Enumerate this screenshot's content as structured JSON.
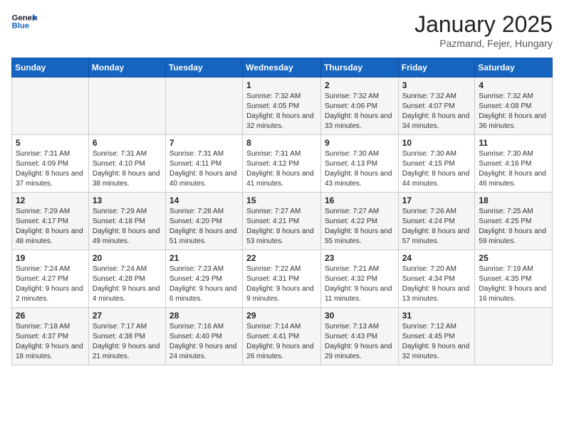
{
  "header": {
    "logo_general": "General",
    "logo_blue": "Blue",
    "month": "January 2025",
    "location": "Pazmand, Fejer, Hungary"
  },
  "days_of_week": [
    "Sunday",
    "Monday",
    "Tuesday",
    "Wednesday",
    "Thursday",
    "Friday",
    "Saturday"
  ],
  "weeks": [
    [
      {
        "day": "",
        "info": ""
      },
      {
        "day": "",
        "info": ""
      },
      {
        "day": "",
        "info": ""
      },
      {
        "day": "1",
        "info": "Sunrise: 7:32 AM\nSunset: 4:05 PM\nDaylight: 8 hours and 32 minutes."
      },
      {
        "day": "2",
        "info": "Sunrise: 7:32 AM\nSunset: 4:06 PM\nDaylight: 8 hours and 33 minutes."
      },
      {
        "day": "3",
        "info": "Sunrise: 7:32 AM\nSunset: 4:07 PM\nDaylight: 8 hours and 34 minutes."
      },
      {
        "day": "4",
        "info": "Sunrise: 7:32 AM\nSunset: 4:08 PM\nDaylight: 8 hours and 36 minutes."
      }
    ],
    [
      {
        "day": "5",
        "info": "Sunrise: 7:31 AM\nSunset: 4:09 PM\nDaylight: 8 hours and 37 minutes."
      },
      {
        "day": "6",
        "info": "Sunrise: 7:31 AM\nSunset: 4:10 PM\nDaylight: 8 hours and 38 minutes."
      },
      {
        "day": "7",
        "info": "Sunrise: 7:31 AM\nSunset: 4:11 PM\nDaylight: 8 hours and 40 minutes."
      },
      {
        "day": "8",
        "info": "Sunrise: 7:31 AM\nSunset: 4:12 PM\nDaylight: 8 hours and 41 minutes."
      },
      {
        "day": "9",
        "info": "Sunrise: 7:30 AM\nSunset: 4:13 PM\nDaylight: 8 hours and 43 minutes."
      },
      {
        "day": "10",
        "info": "Sunrise: 7:30 AM\nSunset: 4:15 PM\nDaylight: 8 hours and 44 minutes."
      },
      {
        "day": "11",
        "info": "Sunrise: 7:30 AM\nSunset: 4:16 PM\nDaylight: 8 hours and 46 minutes."
      }
    ],
    [
      {
        "day": "12",
        "info": "Sunrise: 7:29 AM\nSunset: 4:17 PM\nDaylight: 8 hours and 48 minutes."
      },
      {
        "day": "13",
        "info": "Sunrise: 7:29 AM\nSunset: 4:18 PM\nDaylight: 8 hours and 49 minutes."
      },
      {
        "day": "14",
        "info": "Sunrise: 7:28 AM\nSunset: 4:20 PM\nDaylight: 8 hours and 51 minutes."
      },
      {
        "day": "15",
        "info": "Sunrise: 7:27 AM\nSunset: 4:21 PM\nDaylight: 8 hours and 53 minutes."
      },
      {
        "day": "16",
        "info": "Sunrise: 7:27 AM\nSunset: 4:22 PM\nDaylight: 8 hours and 55 minutes."
      },
      {
        "day": "17",
        "info": "Sunrise: 7:26 AM\nSunset: 4:24 PM\nDaylight: 8 hours and 57 minutes."
      },
      {
        "day": "18",
        "info": "Sunrise: 7:25 AM\nSunset: 4:25 PM\nDaylight: 8 hours and 59 minutes."
      }
    ],
    [
      {
        "day": "19",
        "info": "Sunrise: 7:24 AM\nSunset: 4:27 PM\nDaylight: 9 hours and 2 minutes."
      },
      {
        "day": "20",
        "info": "Sunrise: 7:24 AM\nSunset: 4:28 PM\nDaylight: 9 hours and 4 minutes."
      },
      {
        "day": "21",
        "info": "Sunrise: 7:23 AM\nSunset: 4:29 PM\nDaylight: 9 hours and 6 minutes."
      },
      {
        "day": "22",
        "info": "Sunrise: 7:22 AM\nSunset: 4:31 PM\nDaylight: 9 hours and 9 minutes."
      },
      {
        "day": "23",
        "info": "Sunrise: 7:21 AM\nSunset: 4:32 PM\nDaylight: 9 hours and 11 minutes."
      },
      {
        "day": "24",
        "info": "Sunrise: 7:20 AM\nSunset: 4:34 PM\nDaylight: 9 hours and 13 minutes."
      },
      {
        "day": "25",
        "info": "Sunrise: 7:19 AM\nSunset: 4:35 PM\nDaylight: 9 hours and 16 minutes."
      }
    ],
    [
      {
        "day": "26",
        "info": "Sunrise: 7:18 AM\nSunset: 4:37 PM\nDaylight: 9 hours and 18 minutes."
      },
      {
        "day": "27",
        "info": "Sunrise: 7:17 AM\nSunset: 4:38 PM\nDaylight: 9 hours and 21 minutes."
      },
      {
        "day": "28",
        "info": "Sunrise: 7:16 AM\nSunset: 4:40 PM\nDaylight: 9 hours and 24 minutes."
      },
      {
        "day": "29",
        "info": "Sunrise: 7:14 AM\nSunset: 4:41 PM\nDaylight: 9 hours and 26 minutes."
      },
      {
        "day": "30",
        "info": "Sunrise: 7:13 AM\nSunset: 4:43 PM\nDaylight: 9 hours and 29 minutes."
      },
      {
        "day": "31",
        "info": "Sunrise: 7:12 AM\nSunset: 4:45 PM\nDaylight: 9 hours and 32 minutes."
      },
      {
        "day": "",
        "info": ""
      }
    ]
  ]
}
